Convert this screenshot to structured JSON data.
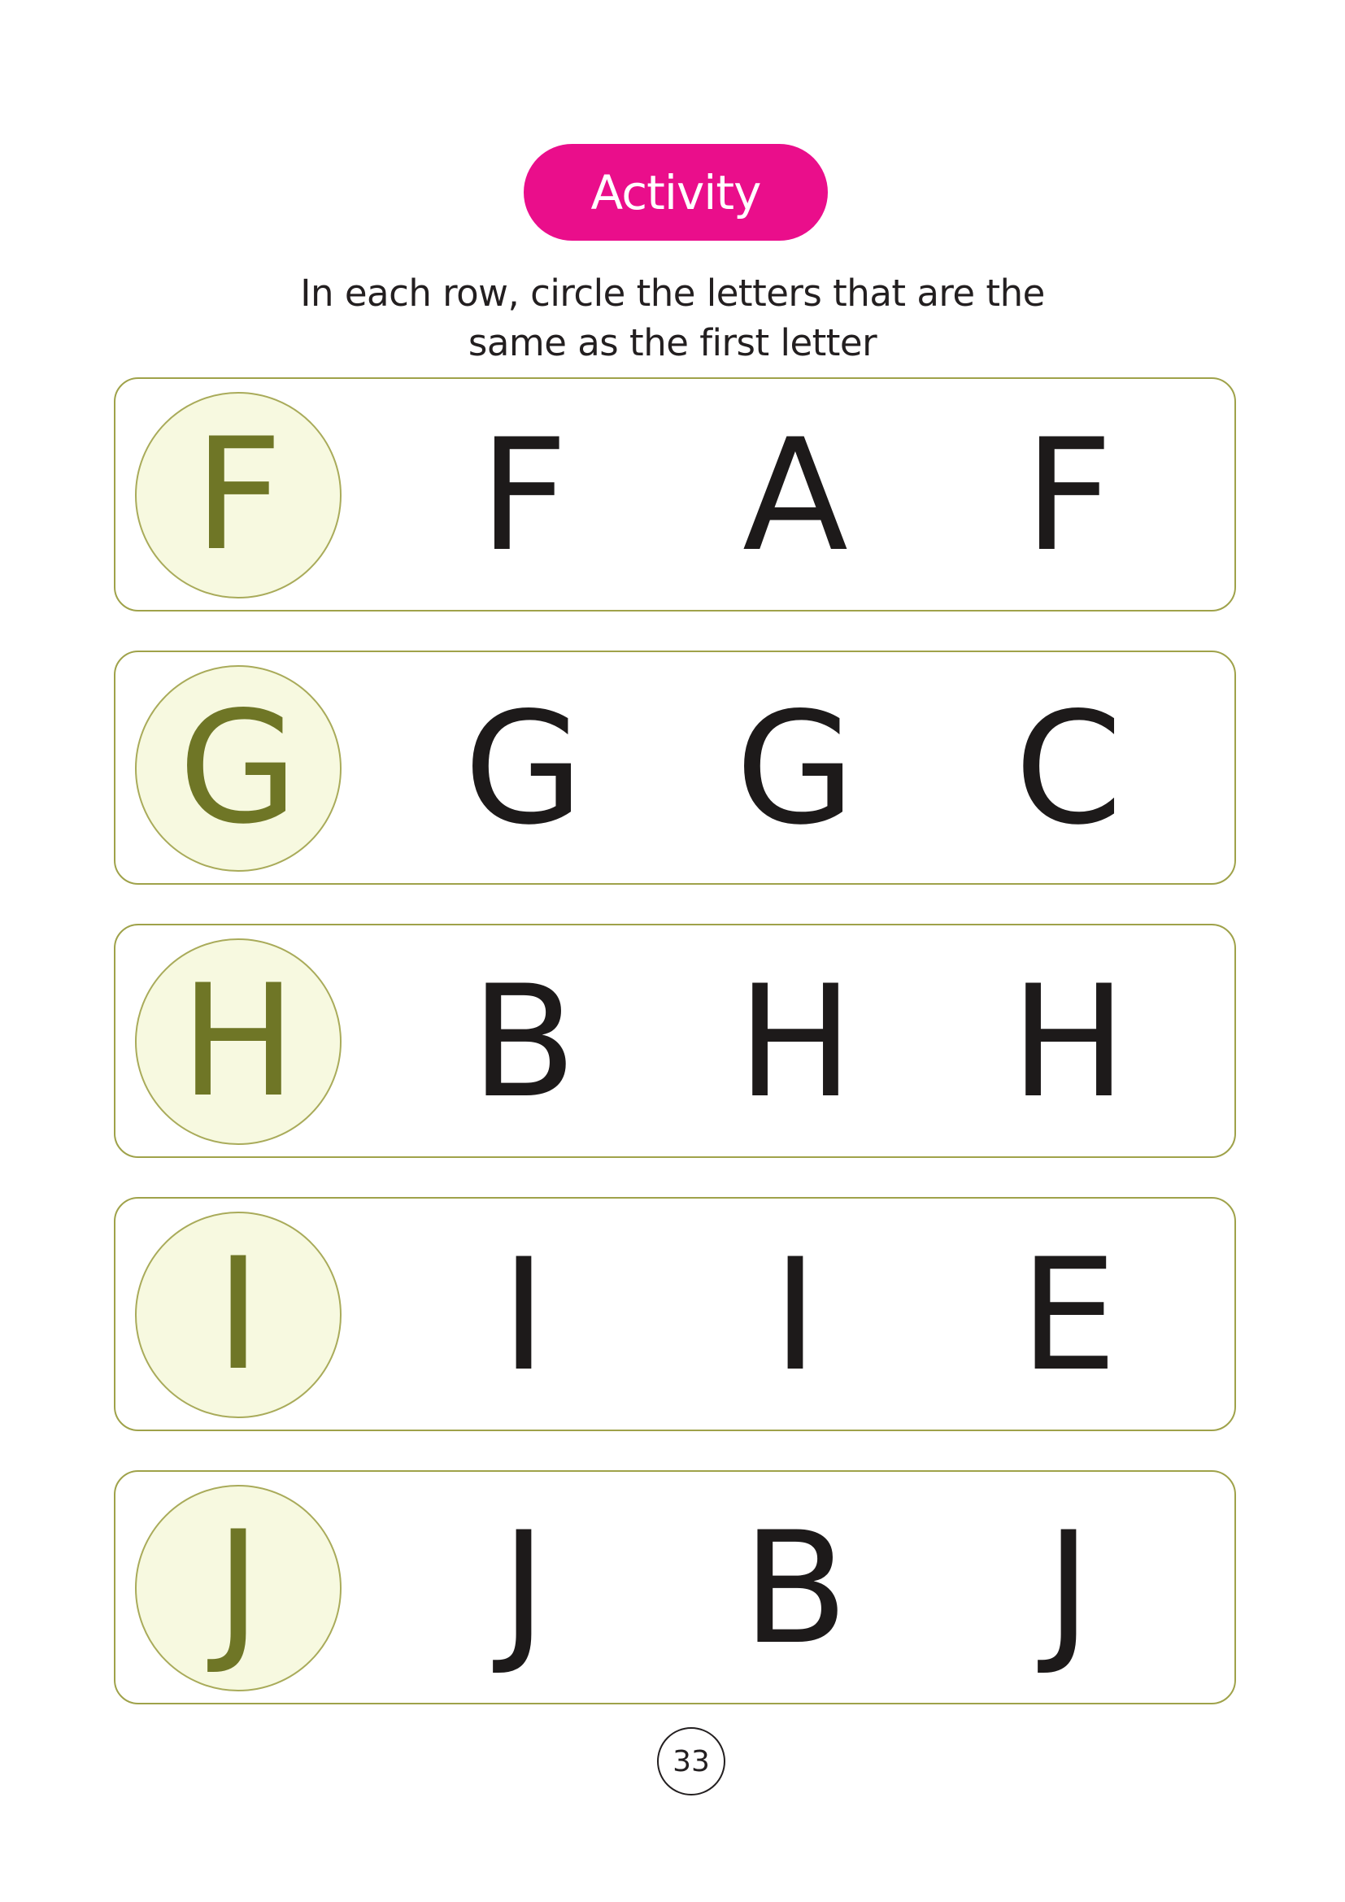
{
  "header": {
    "badge_label": "Activity",
    "instruction_line_1": "In each row, circle the letters that are the",
    "instruction_line_2": "same as the first letter"
  },
  "rows": [
    {
      "target": "F",
      "choices": [
        "F",
        "A",
        "F"
      ]
    },
    {
      "target": "G",
      "choices": [
        "G",
        "G",
        "C"
      ]
    },
    {
      "target": "H",
      "choices": [
        "B",
        "H",
        "H"
      ]
    },
    {
      "target": "I",
      "choices": [
        "I",
        "I",
        "E"
      ]
    },
    {
      "target": "J",
      "choices": [
        "J",
        "B",
        "J"
      ]
    }
  ],
  "footer": {
    "page_number": "33"
  },
  "colors": {
    "badge_background": "#ea0e8b",
    "row_border": "#9fa24a",
    "target_circle_fill": "#f7f9e0",
    "target_letter": "#6f7626",
    "choice_letter": "#1d1a1a"
  }
}
